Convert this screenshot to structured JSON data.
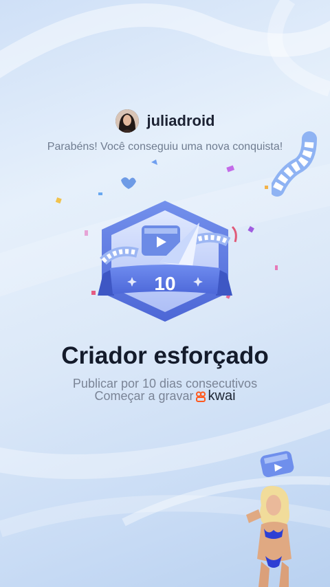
{
  "header": {
    "username": "juliadroid",
    "message": "Parabéns! Você conseguiu uma nova conquista!"
  },
  "badge": {
    "number": "10"
  },
  "achievement": {
    "title": "Criador esforçado",
    "description": "Publicar por 10 dias consecutivos",
    "cta_text": "Começar a gravar",
    "brand": "kwai"
  },
  "colors": {
    "badge_blue": "#5b78e0",
    "badge_light": "#c7d6fb",
    "kwai_orange": "#ff5a1f"
  }
}
